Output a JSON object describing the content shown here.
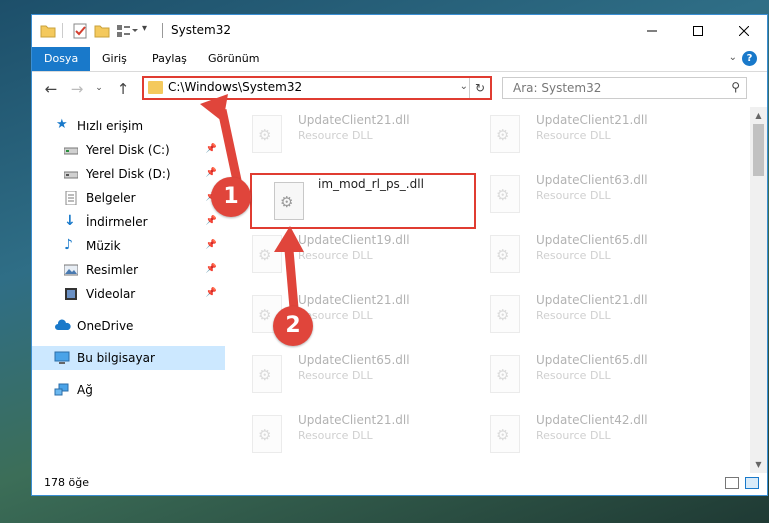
{
  "window": {
    "title": "System32",
    "controls": [
      "minimize",
      "maximize",
      "close"
    ]
  },
  "ribbon": {
    "tabs": [
      {
        "label": "Dosya",
        "active": true
      },
      {
        "label": "Giriş"
      },
      {
        "label": "Paylaş"
      },
      {
        "label": "Görünüm"
      }
    ],
    "help": "?"
  },
  "address": {
    "path": "C:\\Windows\\System32",
    "search_placeholder": "Ara: System32"
  },
  "nav": {
    "items": [
      {
        "label": "Hızlı erişim",
        "icon": "star-icon",
        "pinned": false
      },
      {
        "label": "Yerel Disk (C:)",
        "icon": "drive-icon",
        "pinned": true
      },
      {
        "label": "Yerel Disk (D:)",
        "icon": "drive-icon",
        "pinned": true
      },
      {
        "label": "Belgeler",
        "icon": "documents-icon",
        "pinned": true
      },
      {
        "label": "İndirmeler",
        "icon": "download-icon",
        "pinned": true
      },
      {
        "label": "Müzik",
        "icon": "music-icon",
        "pinned": true
      },
      {
        "label": "Resimler",
        "icon": "pictures-icon",
        "pinned": true
      },
      {
        "label": "Videolar",
        "icon": "video-icon",
        "pinned": true
      },
      {
        "label": "OneDrive",
        "icon": "cloud-icon"
      },
      {
        "label": "Bu bilgisayar",
        "icon": "computer-icon",
        "selected": true
      },
      {
        "label": "Ağ",
        "icon": "network-icon"
      }
    ]
  },
  "files": {
    "col1": [
      {
        "name": "UpdateClient21.dll",
        "type": "Resource DLL"
      },
      {
        "name": "im_mod_rl_ps_.dll",
        "type": "",
        "highlighted": true
      },
      {
        "name": "UpdateClient19.dll",
        "type": "Resource DLL"
      },
      {
        "name": "UpdateClient21.dll",
        "type": "Resource DLL"
      },
      {
        "name": "UpdateClient65.dll",
        "type": "Resource DLL"
      },
      {
        "name": "UpdateClient21.dll",
        "type": "Resource DLL"
      }
    ],
    "col2": [
      {
        "name": "UpdateClient21.dll",
        "type": "Resource DLL"
      },
      {
        "name": "UpdateClient63.dll",
        "type": "Resource DLL"
      },
      {
        "name": "UpdateClient65.dll",
        "type": "Resource DLL"
      },
      {
        "name": "UpdateClient21.dll",
        "type": "Resource DLL"
      },
      {
        "name": "UpdateClient65.dll",
        "type": "Resource DLL"
      },
      {
        "name": "UpdateClient42.dll",
        "type": "Resource DLL"
      }
    ]
  },
  "status": {
    "count": "178 öğe"
  },
  "annotations": {
    "marker1": "1",
    "marker2": "2",
    "color": "#e0453b"
  }
}
